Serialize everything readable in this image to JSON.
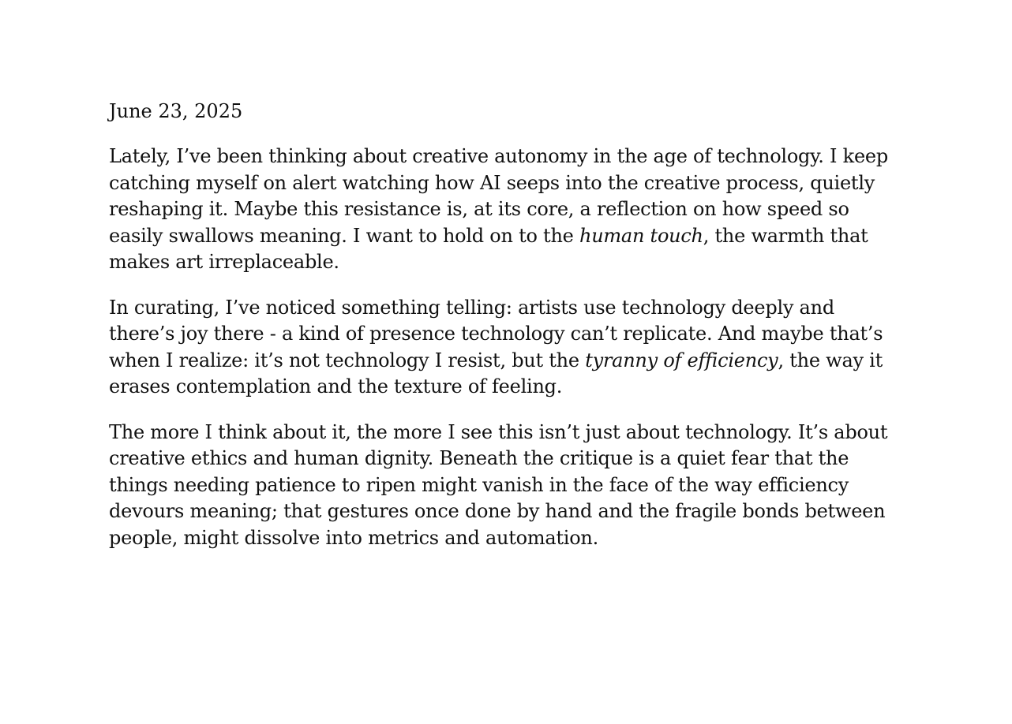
{
  "entry": {
    "date": "June 23, 2025",
    "paragraphs": [
      {
        "before": "Lately, I’ve been thinking about creative autonomy in the age of technology. I keep catching myself on alert watching how AI seeps into the creative process, quietly reshaping it. Maybe this resistance is, at its core, a reflection on how speed so easily swallows meaning. I want to hold on to the ",
        "emphasis": "human touch",
        "after": ", the warmth that makes art irreplaceable."
      },
      {
        "before": "In curating, I’ve noticed something telling: artists use technology deeply and there’s joy there - a kind of presence technology can’t replicate. And maybe that’s when I realize: it’s not technology I resist, but the ",
        "emphasis": "tyranny of efficiency",
        "after": ", the way it erases contemplation and the texture of feeling."
      },
      {
        "text": "The more I think about it, the more I see this isn’t just about technology. It’s about creative ethics and human dignity. Beneath the critique is a quiet fear that the things needing patience to ripen might vanish in the face of the way efficiency devours meaning; that gestures once done by hand and the fragile bonds between people, might dissolve into metrics and automation."
      }
    ]
  }
}
